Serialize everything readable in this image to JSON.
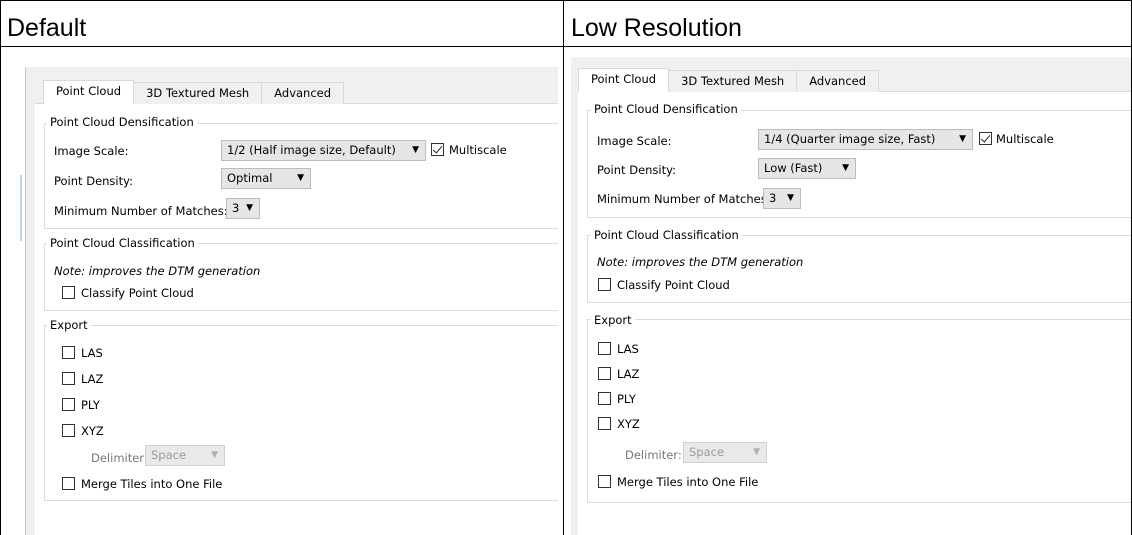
{
  "columns": [
    {
      "heading": "Default",
      "tabs": [
        "Point Cloud",
        "3D Textured Mesh",
        "Advanced"
      ],
      "densification": {
        "title": "Point Cloud Densification",
        "image_scale_label": "Image Scale:",
        "image_scale_value": "1/2 (Half image size, Default)",
        "multiscale_label": "Multiscale",
        "multiscale_checked": true,
        "point_density_label": "Point Density:",
        "point_density_value": "Optimal",
        "min_matches_label": "Minimum Number of Matches:",
        "min_matches_value": "3"
      },
      "classification": {
        "title": "Point Cloud Classification",
        "note": "Note: improves the DTM generation",
        "classify_label": "Classify Point Cloud"
      },
      "export": {
        "title": "Export",
        "options": [
          "LAS",
          "LAZ",
          "PLY",
          "XYZ"
        ],
        "delimiter_label": "Delimiter:",
        "delimiter_value": "Space",
        "merge_label": "Merge Tiles into One File"
      }
    },
    {
      "heading": "Low Resolution",
      "tabs": [
        "Point Cloud",
        "3D Textured Mesh",
        "Advanced"
      ],
      "densification": {
        "title": "Point Cloud Densification",
        "image_scale_label": "Image Scale:",
        "image_scale_value": "1/4 (Quarter image size, Fast)",
        "multiscale_label": "Multiscale",
        "multiscale_checked": true,
        "point_density_label": "Point Density:",
        "point_density_value": "Low (Fast)",
        "min_matches_label": "Minimum Number of Matches:",
        "min_matches_value": "3"
      },
      "classification": {
        "title": "Point Cloud Classification",
        "note": "Note: improves the DTM generation",
        "classify_label": "Classify Point Cloud"
      },
      "export": {
        "title": "Export",
        "options": [
          "LAS",
          "LAZ",
          "PLY",
          "XYZ"
        ],
        "delimiter_label": "Delimiter:",
        "delimiter_value": "Space",
        "merge_label": "Merge Tiles into One File"
      }
    }
  ]
}
